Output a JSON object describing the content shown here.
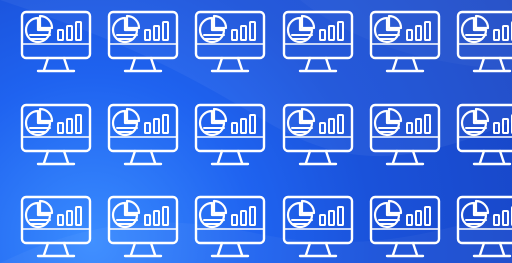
{
  "scene": {
    "background": {
      "name": "blue-abstract-background",
      "colors": [
        "#3a8cff",
        "#1f63f0",
        "#1a52da",
        "#1845c5"
      ]
    },
    "icon": {
      "name": "desktop-monitor-analytics-icon",
      "stroke_color": "#ffffff",
      "rows": 3,
      "columns": 6
    }
  }
}
